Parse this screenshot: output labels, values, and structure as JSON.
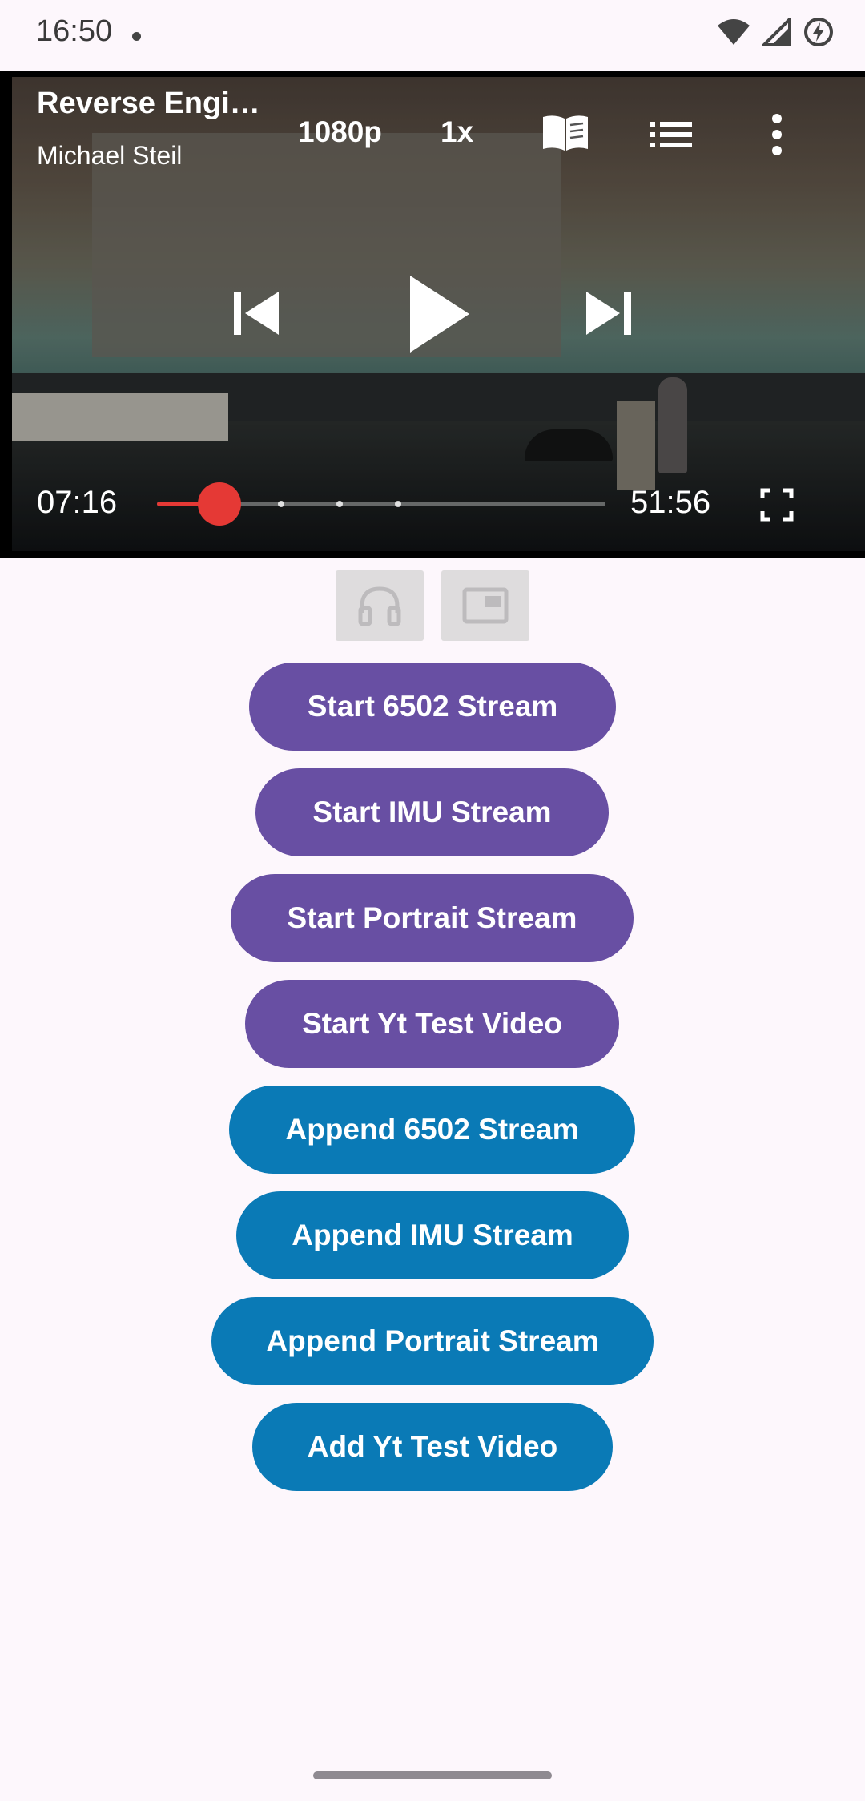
{
  "status_bar": {
    "time": "16:50"
  },
  "player": {
    "title": "Reverse Engi…",
    "author": "Michael Steil",
    "quality": "1080p",
    "speed": "1x",
    "current_time": "07:16",
    "total_time": "51:56",
    "progress_fraction": 0.14,
    "chapter_markers": [
      0.14,
      0.27,
      0.4,
      0.53
    ],
    "accent_color": "#e53935"
  },
  "mode_buttons": [
    "headphones-icon",
    "picture-in-picture-icon"
  ],
  "buttons": {
    "start_6502": "Start 6502 Stream",
    "start_imu": "Start IMU Stream",
    "start_portrait": "Start Portrait Stream",
    "start_yt": "Start Yt Test Video",
    "append_6502": "Append 6502 Stream",
    "append_imu": "Append IMU Stream",
    "append_portrait": "Append Portrait Stream",
    "add_yt": "Add Yt Test Video"
  },
  "colors": {
    "start_button": "#684fa3",
    "append_button": "#0a7ab6",
    "background": "#fdf7fc"
  }
}
